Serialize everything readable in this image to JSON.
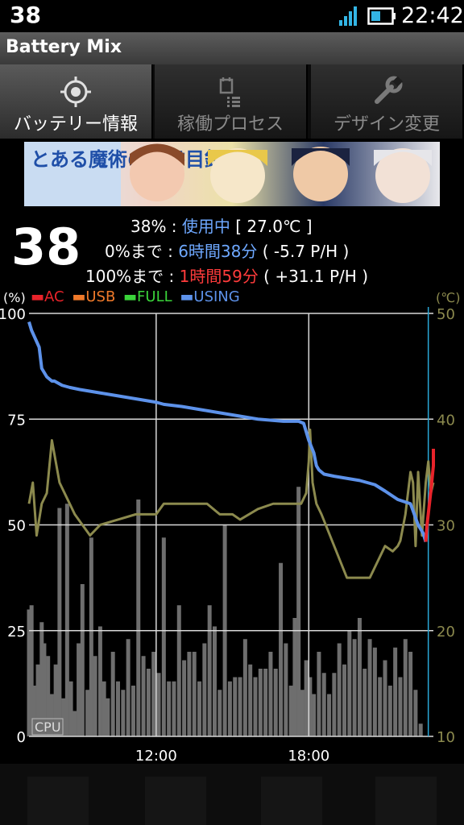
{
  "status_bar": {
    "battery_level": "38",
    "time": "22:42"
  },
  "app": {
    "title": "Battery Mix"
  },
  "tabs": [
    {
      "label": "バッテリー情報",
      "icon": "gps-target-icon",
      "active": true
    },
    {
      "label": "稼働プロセス",
      "icon": "process-list-icon",
      "active": false
    },
    {
      "label": "デザイン変更",
      "icon": "wrench-icon",
      "active": false
    }
  ],
  "banner": {
    "alt": "とある魔術の禁書目録"
  },
  "battery": {
    "level": "38",
    "summary": {
      "percent": "38%",
      "sep": " : ",
      "state": "使用中",
      "temp": "[ 27.0℃ ]"
    },
    "to_empty": {
      "label": "0%まで",
      "sep": " : ",
      "time": "6時間38分",
      "rate": " ( -5.7 P/H )"
    },
    "to_full": {
      "label": "100%まで",
      "sep": " : ",
      "time": "1時間59分",
      "rate": " ( +31.1 P/H )"
    }
  },
  "legend": [
    {
      "label": "AC",
      "color": "#e8232a"
    },
    {
      "label": "USB",
      "color": "#f07a2a"
    },
    {
      "label": "FULL",
      "color": "#3ad43a"
    },
    {
      "label": "USING",
      "color": "#5d92ea"
    }
  ],
  "chart_data": {
    "type": "line",
    "y_left_label": "(%)",
    "y_right_label": "(℃)",
    "y_left_ticks": [
      "100",
      "75",
      "50",
      "25",
      "0"
    ],
    "y_right_ticks": [
      "50",
      "40",
      "30",
      "20",
      "10"
    ],
    "ylim_left": [
      0,
      100
    ],
    "ylim_right": [
      10,
      50
    ],
    "xlim": [
      7.0,
      22.9
    ],
    "x_ticks": [
      "12:00",
      "18:00"
    ],
    "x_tick_values": [
      12,
      18
    ],
    "bar_label": "CPU",
    "grid": true,
    "current_time": 22.7,
    "battery_using": {
      "name": "USING",
      "color": "#5d92ea",
      "x": [
        7.0,
        7.1,
        7.4,
        7.5,
        7.7,
        7.9,
        8.0,
        8.3,
        8.6,
        9.0,
        9.5,
        10.0,
        10.5,
        11.0,
        11.5,
        12.0,
        12.3,
        13.0,
        14.0,
        15.0,
        16.0,
        17.0,
        17.6,
        17.8,
        18.0,
        18.2,
        18.3,
        18.4,
        18.6,
        19.0,
        20.0,
        20.6,
        21.0,
        21.5,
        22.0,
        22.3,
        22.5,
        22.6
      ],
      "y": [
        98,
        96,
        92,
        87,
        85,
        84,
        84,
        83,
        82.5,
        82,
        81.5,
        81,
        80.5,
        80,
        79.5,
        79,
        78.5,
        78,
        77,
        76,
        75,
        74.5,
        74.5,
        74,
        70,
        67,
        64,
        63,
        62,
        61.5,
        60.5,
        59.5,
        58,
        56,
        55,
        50,
        48,
        46
      ]
    },
    "battery_ac": {
      "name": "AC",
      "color": "#e8232a",
      "x": [
        22.6,
        22.65,
        22.8,
        22.9,
        23.0
      ],
      "y": [
        46,
        50,
        58,
        64,
        68
      ]
    },
    "temperature": {
      "color": "#8c8a4e",
      "x": [
        7.0,
        7.15,
        7.3,
        7.5,
        7.7,
        7.9,
        8.2,
        8.5,
        8.8,
        9.1,
        9.4,
        9.8,
        10.5,
        11.2,
        12.0,
        12.3,
        13.0,
        14.0,
        14.5,
        15.0,
        15.3,
        16.0,
        16.6,
        17.0,
        17.7,
        17.9,
        18.0,
        18.05,
        18.15,
        18.3,
        18.5,
        19.0,
        19.5,
        20.0,
        20.4,
        20.8,
        21.0,
        21.3,
        21.5,
        21.6,
        21.8,
        22.0,
        22.1,
        22.2,
        22.3,
        22.35,
        22.45,
        22.6,
        22.7,
        22.8,
        22.9
      ],
      "y": [
        32,
        34,
        29,
        32,
        33,
        38,
        34,
        32.5,
        31,
        30,
        29,
        30,
        30.5,
        31,
        31,
        32,
        32,
        32,
        31,
        31,
        30.5,
        31.5,
        32,
        32,
        32,
        33,
        36,
        39,
        34,
        32,
        31,
        28,
        25,
        25,
        25,
        27,
        28,
        27.5,
        28,
        28.5,
        31,
        35,
        34,
        28,
        35,
        33,
        29,
        34,
        36,
        33,
        34
      ]
    },
    "cpu_bars": {
      "color": "#6e6e6e",
      "x": [
        7.0,
        7.1,
        7.2,
        7.35,
        7.5,
        7.6,
        7.75,
        7.9,
        8.05,
        8.2,
        8.35,
        8.5,
        8.65,
        8.8,
        8.95,
        9.1,
        9.3,
        9.45,
        9.6,
        9.8,
        9.95,
        10.1,
        10.3,
        10.5,
        10.7,
        10.9,
        11.1,
        11.3,
        11.5,
        11.7,
        11.9,
        12.1,
        12.3,
        12.5,
        12.7,
        12.9,
        13.1,
        13.3,
        13.5,
        13.7,
        13.9,
        14.1,
        14.3,
        14.5,
        14.7,
        14.9,
        15.1,
        15.3,
        15.5,
        15.7,
        15.9,
        16.1,
        16.3,
        16.5,
        16.7,
        16.9,
        17.1,
        17.3,
        17.45,
        17.6,
        17.75,
        17.9,
        18.05,
        18.2,
        18.4,
        18.6,
        18.8,
        19.0,
        19.2,
        19.4,
        19.6,
        19.8,
        20.0,
        20.2,
        20.4,
        20.6,
        20.8,
        21.0,
        21.2,
        21.4,
        21.6,
        21.8,
        22.0,
        22.2,
        22.4
      ],
      "y": [
        30,
        31,
        12,
        17,
        27,
        22,
        19,
        10,
        17,
        54,
        9,
        55,
        13,
        6,
        22,
        36,
        11,
        47,
        19,
        26,
        13,
        9,
        20,
        13,
        11,
        23,
        12,
        56,
        19,
        16,
        20,
        15,
        47,
        13,
        13,
        31,
        18,
        20,
        20,
        13,
        22,
        31,
        26,
        11,
        50,
        13,
        14,
        14,
        23,
        17,
        14,
        16,
        16,
        20,
        16,
        41,
        22,
        12,
        28,
        59,
        11,
        18,
        14,
        10,
        20,
        15,
        10,
        15,
        22,
        17,
        25,
        23,
        28,
        16,
        23,
        21,
        14,
        18,
        12,
        21,
        14,
        23,
        20,
        11,
        3
      ]
    }
  }
}
